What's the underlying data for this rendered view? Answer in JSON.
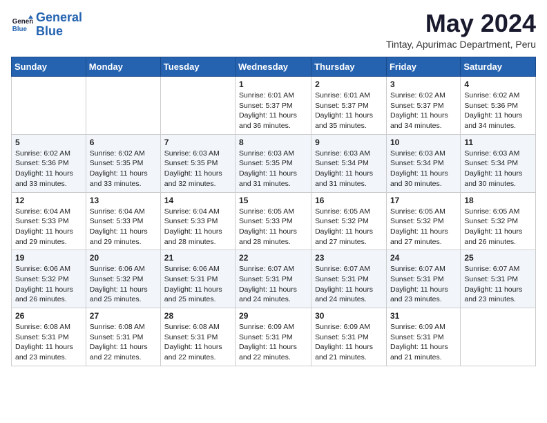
{
  "logo": {
    "line1": "General",
    "line2": "Blue"
  },
  "title": {
    "month_year": "May 2024",
    "location": "Tintay, Apurimac Department, Peru"
  },
  "weekdays": [
    "Sunday",
    "Monday",
    "Tuesday",
    "Wednesday",
    "Thursday",
    "Friday",
    "Saturday"
  ],
  "weeks": [
    [
      {
        "day": "",
        "info": ""
      },
      {
        "day": "",
        "info": ""
      },
      {
        "day": "",
        "info": ""
      },
      {
        "day": "1",
        "info": "Sunrise: 6:01 AM\nSunset: 5:37 PM\nDaylight: 11 hours\nand 36 minutes."
      },
      {
        "day": "2",
        "info": "Sunrise: 6:01 AM\nSunset: 5:37 PM\nDaylight: 11 hours\nand 35 minutes."
      },
      {
        "day": "3",
        "info": "Sunrise: 6:02 AM\nSunset: 5:37 PM\nDaylight: 11 hours\nand 34 minutes."
      },
      {
        "day": "4",
        "info": "Sunrise: 6:02 AM\nSunset: 5:36 PM\nDaylight: 11 hours\nand 34 minutes."
      }
    ],
    [
      {
        "day": "5",
        "info": "Sunrise: 6:02 AM\nSunset: 5:36 PM\nDaylight: 11 hours\nand 33 minutes."
      },
      {
        "day": "6",
        "info": "Sunrise: 6:02 AM\nSunset: 5:35 PM\nDaylight: 11 hours\nand 33 minutes."
      },
      {
        "day": "7",
        "info": "Sunrise: 6:03 AM\nSunset: 5:35 PM\nDaylight: 11 hours\nand 32 minutes."
      },
      {
        "day": "8",
        "info": "Sunrise: 6:03 AM\nSunset: 5:35 PM\nDaylight: 11 hours\nand 31 minutes."
      },
      {
        "day": "9",
        "info": "Sunrise: 6:03 AM\nSunset: 5:34 PM\nDaylight: 11 hours\nand 31 minutes."
      },
      {
        "day": "10",
        "info": "Sunrise: 6:03 AM\nSunset: 5:34 PM\nDaylight: 11 hours\nand 30 minutes."
      },
      {
        "day": "11",
        "info": "Sunrise: 6:03 AM\nSunset: 5:34 PM\nDaylight: 11 hours\nand 30 minutes."
      }
    ],
    [
      {
        "day": "12",
        "info": "Sunrise: 6:04 AM\nSunset: 5:33 PM\nDaylight: 11 hours\nand 29 minutes."
      },
      {
        "day": "13",
        "info": "Sunrise: 6:04 AM\nSunset: 5:33 PM\nDaylight: 11 hours\nand 29 minutes."
      },
      {
        "day": "14",
        "info": "Sunrise: 6:04 AM\nSunset: 5:33 PM\nDaylight: 11 hours\nand 28 minutes."
      },
      {
        "day": "15",
        "info": "Sunrise: 6:05 AM\nSunset: 5:33 PM\nDaylight: 11 hours\nand 28 minutes."
      },
      {
        "day": "16",
        "info": "Sunrise: 6:05 AM\nSunset: 5:32 PM\nDaylight: 11 hours\nand 27 minutes."
      },
      {
        "day": "17",
        "info": "Sunrise: 6:05 AM\nSunset: 5:32 PM\nDaylight: 11 hours\nand 27 minutes."
      },
      {
        "day": "18",
        "info": "Sunrise: 6:05 AM\nSunset: 5:32 PM\nDaylight: 11 hours\nand 26 minutes."
      }
    ],
    [
      {
        "day": "19",
        "info": "Sunrise: 6:06 AM\nSunset: 5:32 PM\nDaylight: 11 hours\nand 26 minutes."
      },
      {
        "day": "20",
        "info": "Sunrise: 6:06 AM\nSunset: 5:32 PM\nDaylight: 11 hours\nand 25 minutes."
      },
      {
        "day": "21",
        "info": "Sunrise: 6:06 AM\nSunset: 5:31 PM\nDaylight: 11 hours\nand 25 minutes."
      },
      {
        "day": "22",
        "info": "Sunrise: 6:07 AM\nSunset: 5:31 PM\nDaylight: 11 hours\nand 24 minutes."
      },
      {
        "day": "23",
        "info": "Sunrise: 6:07 AM\nSunset: 5:31 PM\nDaylight: 11 hours\nand 24 minutes."
      },
      {
        "day": "24",
        "info": "Sunrise: 6:07 AM\nSunset: 5:31 PM\nDaylight: 11 hours\nand 23 minutes."
      },
      {
        "day": "25",
        "info": "Sunrise: 6:07 AM\nSunset: 5:31 PM\nDaylight: 11 hours\nand 23 minutes."
      }
    ],
    [
      {
        "day": "26",
        "info": "Sunrise: 6:08 AM\nSunset: 5:31 PM\nDaylight: 11 hours\nand 23 minutes."
      },
      {
        "day": "27",
        "info": "Sunrise: 6:08 AM\nSunset: 5:31 PM\nDaylight: 11 hours\nand 22 minutes."
      },
      {
        "day": "28",
        "info": "Sunrise: 6:08 AM\nSunset: 5:31 PM\nDaylight: 11 hours\nand 22 minutes."
      },
      {
        "day": "29",
        "info": "Sunrise: 6:09 AM\nSunset: 5:31 PM\nDaylight: 11 hours\nand 22 minutes."
      },
      {
        "day": "30",
        "info": "Sunrise: 6:09 AM\nSunset: 5:31 PM\nDaylight: 11 hours\nand 21 minutes."
      },
      {
        "day": "31",
        "info": "Sunrise: 6:09 AM\nSunset: 5:31 PM\nDaylight: 11 hours\nand 21 minutes."
      },
      {
        "day": "",
        "info": ""
      }
    ]
  ]
}
